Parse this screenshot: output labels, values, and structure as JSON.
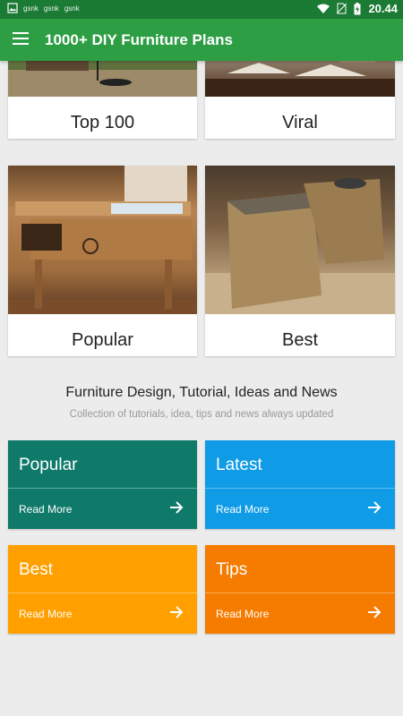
{
  "status_bar": {
    "time": "20.44",
    "tags": [
      "gsnk",
      "gsnk",
      "gsnk"
    ]
  },
  "app_bar": {
    "title": "1000+ DIY Furniture Plans"
  },
  "categories": [
    {
      "label": "Top 100",
      "image": "patio-set-photo"
    },
    {
      "label": "Viral",
      "image": "patio-lounge-photo"
    },
    {
      "label": "Popular",
      "image": "wooden-cooler-cart-photo"
    },
    {
      "label": "Best",
      "image": "bamboo-table-photo"
    }
  ],
  "section": {
    "title": "Furniture Design, Tutorial, Ideas and News",
    "subtitle": "Collection of tutorials, idea, tips and news always updated"
  },
  "tiles": [
    {
      "title": "Popular",
      "action": "Read More",
      "color": "#0f7a6a"
    },
    {
      "title": "Latest",
      "action": "Read More",
      "color": "#0f9be6"
    },
    {
      "title": "Best",
      "action": "Read More",
      "color": "#ffa000"
    },
    {
      "title": "Tips",
      "action": "Read More",
      "color": "#f57c00"
    }
  ],
  "icons": [
    "image-icon",
    "wifi-icon",
    "no-sim-icon",
    "battery-icon",
    "menu-icon",
    "arrow-right-icon"
  ]
}
